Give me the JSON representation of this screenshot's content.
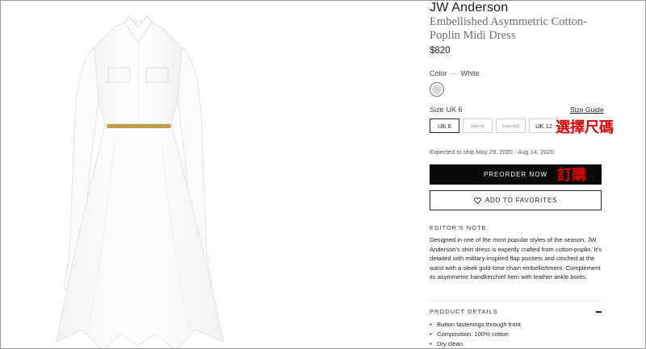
{
  "product": {
    "brand": "JW Anderson",
    "name": "Embellished Asymmetric Cotton-Poplin Midi Dress",
    "price": "$820",
    "color_label": "Color",
    "color_sep": "—",
    "color_value": "White",
    "swatch_color": "#d8d8d8"
  },
  "sizes": {
    "label": "Size",
    "selected_value": "UK 6",
    "guide_label": "Size Guide",
    "options": [
      {
        "label": "UK 6",
        "state": "selected"
      },
      {
        "label": "UK 8",
        "state": "sold-out"
      },
      {
        "label": "UK 10",
        "state": "sold-out"
      },
      {
        "label": "UK 12",
        "state": "available"
      }
    ]
  },
  "annotations": {
    "select_size": "選擇尺碼",
    "order": "訂購",
    "color": "#e00000"
  },
  "shipping": {
    "text": "Expected to ship May 29, 2020 - Aug 14, 2020"
  },
  "actions": {
    "preorder_label": "PREORDER NOW",
    "favorites_label": "ADD TO FAVORITES",
    "heart_icon": "heart-icon"
  },
  "editors_note": {
    "title": "EDITOR'S NOTE",
    "body": "Designed in one of the most popular styles of the season, JW Anderson's shirt dress is expertly crafted from cotton-poplin. It's detailed with military-inspired flap pockets and cinched at the waist with a sleek gold-tone chain embellishment. Complement its asymmetric handkerchief hem with leather ankle boots."
  },
  "product_details": {
    "title": "PRODUCT DETAILS",
    "toggle_icon": "minus-icon",
    "items": [
      "Button fastenings through front",
      "Composition: 100% cotton",
      "Dry clean"
    ]
  },
  "colors": {
    "button_black": "#0a0a0a",
    "text": "#222222",
    "muted": "#6e6e6e"
  }
}
